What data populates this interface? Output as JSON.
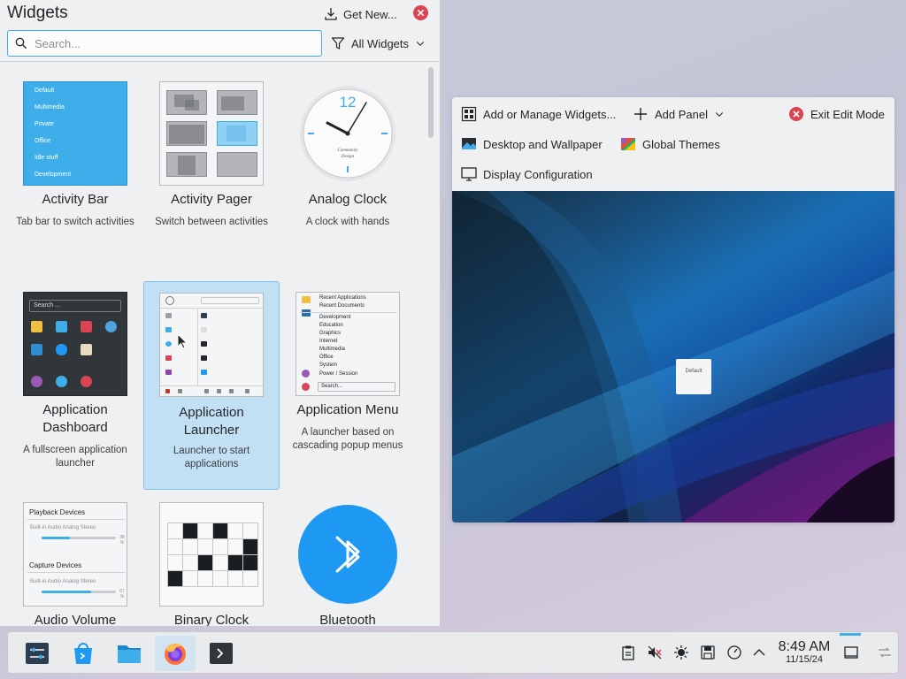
{
  "sidebar": {
    "title": "Widgets",
    "get_new_label": "Get New...",
    "search_placeholder": "Search...",
    "filter_label": "All Widgets",
    "widgets": [
      {
        "name": "Activity Bar",
        "description": "Tab bar to switch activities"
      },
      {
        "name": "Activity Pager",
        "description": "Switch between activities"
      },
      {
        "name": "Analog Clock",
        "description": "A clock with hands"
      },
      {
        "name": "Application Dashboard",
        "description": "A fullscreen application launcher"
      },
      {
        "name": "Application Launcher",
        "description": "Launcher to start applications"
      },
      {
        "name": "Application Menu",
        "description": "A launcher based on cascading popup menus"
      },
      {
        "name": "Audio Volume",
        "description": ""
      },
      {
        "name": "Binary Clock",
        "description": ""
      },
      {
        "name": "Bluetooth",
        "description": ""
      }
    ],
    "activity_bar_items": [
      "Default",
      "Multimedia",
      "Private",
      "Office",
      "Idle stuff",
      "Development"
    ],
    "dashboard_search": "Search ...",
    "app_menu_items": [
      "Recent Applications",
      "Recent Documents",
      "Development",
      "Education",
      "Graphics",
      "Internet",
      "Multimedia",
      "Office",
      "System",
      "Power / Session",
      "Search..."
    ],
    "audio_thumb": {
      "playback_label": "Playback Devices",
      "playback_device": "Built-in Audio Analog Stereo",
      "playback_pct": "38 %",
      "playback_level": 0.38,
      "capture_label": "Capture Devices",
      "capture_device": "Built-in Audio Analog Stereo",
      "capture_pct": "67 %",
      "capture_level": 0.67
    }
  },
  "edit_toolbar": {
    "add_widgets": "Add or Manage Widgets...",
    "add_panel": "Add Panel",
    "exit_edit": "Exit Edit Mode",
    "desktop_wallpaper": "Desktop and Wallpaper",
    "global_themes": "Global Themes",
    "display_config": "Display Configuration",
    "activity_tile": "Default"
  },
  "taskbar": {
    "time": "8:49 AM",
    "date": "11/15/24",
    "apps": [
      "settings-icon",
      "discover-icon",
      "files-icon",
      "firefox-icon",
      "terminal-icon"
    ],
    "tray": [
      "clipboard-icon",
      "volume-muted-icon",
      "brightness-icon",
      "storage-icon",
      "updates-icon",
      "chevron-up-icon"
    ]
  },
  "colors": {
    "accent": "#3daee9",
    "close": "#da4453",
    "panel_bg": "#eff0f1"
  }
}
